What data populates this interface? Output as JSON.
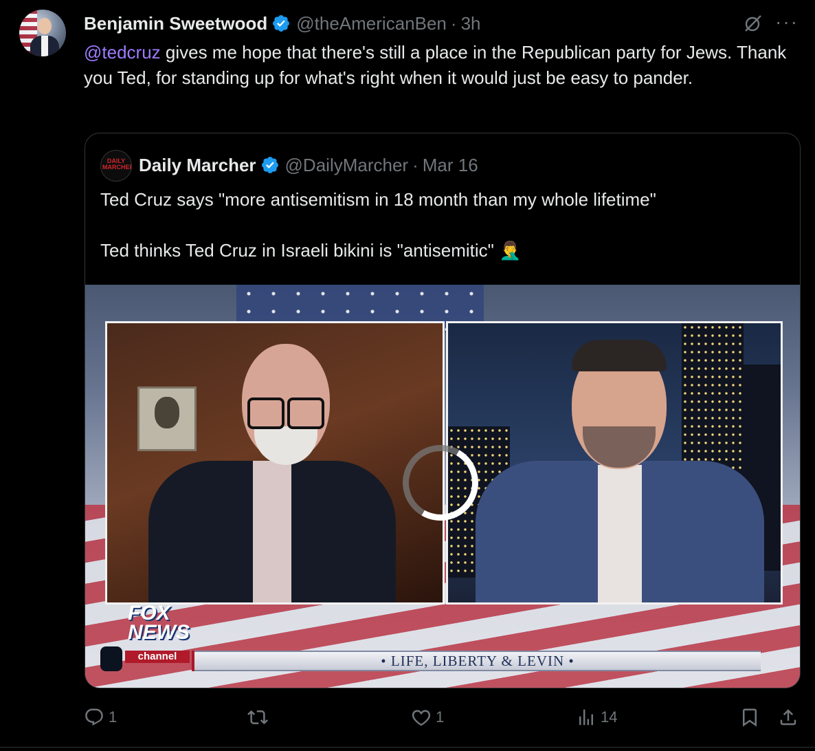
{
  "tweet": {
    "author_name": "Benjamin Sweetwood",
    "handle": "@theAmericanBen",
    "separator": "·",
    "time": "3h",
    "mention": "@tedcruz",
    "text_rest": " gives me hope that there's still a place in the Republican party for Jews. Thank you Ted, for standing up for what's right when it would just be easy to pander."
  },
  "quote": {
    "avatar_text": "DAILY MARCHER",
    "author_name": "Daily Marcher",
    "handle": "@DailyMarcher",
    "separator": "·",
    "date": "Mar 16",
    "line1": "Ted Cruz says \"more antisemitism in 18 month than my whole lifetime\"",
    "line2": "Ted thinks Ted Cruz in Israeli bikini is \"antisemitic\" 🤦‍♂️",
    "media": {
      "logo_line1": "FOX",
      "logo_line2": "NEWS",
      "logo_line3": "channel",
      "banner_text": "• LIFE, LIBERTY & LEVIN •"
    }
  },
  "actions": {
    "replies": "1",
    "reposts": "",
    "likes": "1",
    "views": "14"
  },
  "icons": {
    "verified": "verified-badge-icon",
    "grok": "grok-icon",
    "more": "more-icon",
    "reply": "reply-icon",
    "repost": "repost-icon",
    "like": "heart-icon",
    "views": "views-chart-icon",
    "bookmark": "bookmark-icon",
    "share": "share-icon"
  },
  "colors": {
    "background": "#000000",
    "text": "#e7e9ea",
    "muted": "#71767b",
    "mention": "#9e7bff",
    "verified": "#1d9bf0",
    "border": "#333639"
  }
}
